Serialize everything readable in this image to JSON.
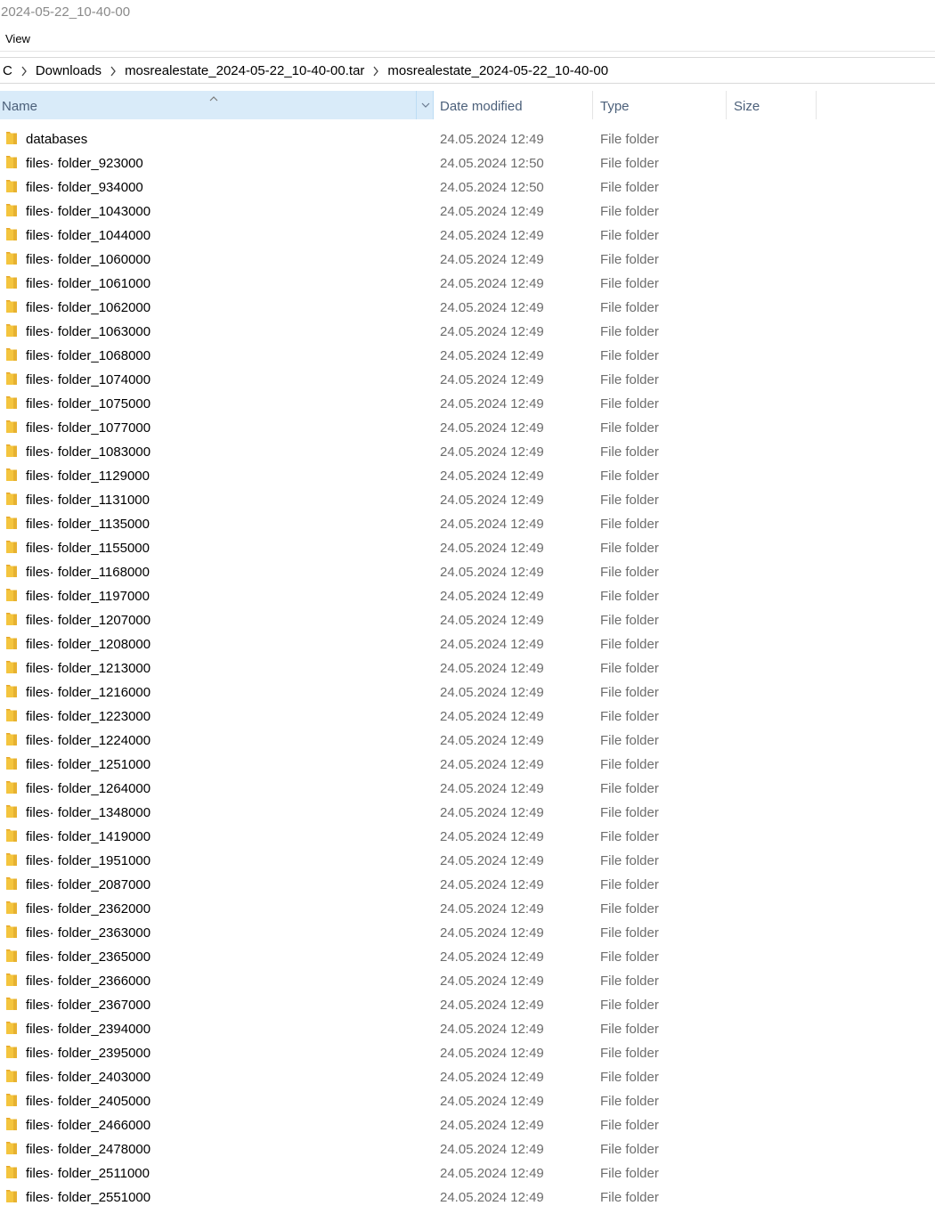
{
  "window": {
    "title": "2024-05-22_10-40-00"
  },
  "menu": {
    "view_label": "View"
  },
  "breadcrumb": [
    "C",
    "Downloads",
    "mosrealestate_2024-05-22_10-40-00.tar",
    "mosrealestate_2024-05-22_10-40-00"
  ],
  "columns": {
    "name": "Name",
    "date": "Date modified",
    "type": "Type",
    "size": "Size"
  },
  "colors": {
    "header_selected_bg": "#d9ebf9",
    "header_text": "#4c607a",
    "folder_icon": "#f4c53e",
    "secondary_text": "#6d6d6d"
  },
  "files": [
    {
      "name": "databases",
      "date": "24.05.2024 12:49",
      "type": "File folder",
      "size": ""
    },
    {
      "name": "files· folder_923000",
      "date": "24.05.2024 12:50",
      "type": "File folder",
      "size": ""
    },
    {
      "name": "files· folder_934000",
      "date": "24.05.2024 12:50",
      "type": "File folder",
      "size": ""
    },
    {
      "name": "files· folder_1043000",
      "date": "24.05.2024 12:49",
      "type": "File folder",
      "size": ""
    },
    {
      "name": "files· folder_1044000",
      "date": "24.05.2024 12:49",
      "type": "File folder",
      "size": ""
    },
    {
      "name": "files· folder_1060000",
      "date": "24.05.2024 12:49",
      "type": "File folder",
      "size": ""
    },
    {
      "name": "files· folder_1061000",
      "date": "24.05.2024 12:49",
      "type": "File folder",
      "size": ""
    },
    {
      "name": "files· folder_1062000",
      "date": "24.05.2024 12:49",
      "type": "File folder",
      "size": ""
    },
    {
      "name": "files· folder_1063000",
      "date": "24.05.2024 12:49",
      "type": "File folder",
      "size": ""
    },
    {
      "name": "files· folder_1068000",
      "date": "24.05.2024 12:49",
      "type": "File folder",
      "size": ""
    },
    {
      "name": "files· folder_1074000",
      "date": "24.05.2024 12:49",
      "type": "File folder",
      "size": ""
    },
    {
      "name": "files· folder_1075000",
      "date": "24.05.2024 12:49",
      "type": "File folder",
      "size": ""
    },
    {
      "name": "files· folder_1077000",
      "date": "24.05.2024 12:49",
      "type": "File folder",
      "size": ""
    },
    {
      "name": "files· folder_1083000",
      "date": "24.05.2024 12:49",
      "type": "File folder",
      "size": ""
    },
    {
      "name": "files· folder_1129000",
      "date": "24.05.2024 12:49",
      "type": "File folder",
      "size": ""
    },
    {
      "name": "files· folder_1131000",
      "date": "24.05.2024 12:49",
      "type": "File folder",
      "size": ""
    },
    {
      "name": "files· folder_1135000",
      "date": "24.05.2024 12:49",
      "type": "File folder",
      "size": ""
    },
    {
      "name": "files· folder_1155000",
      "date": "24.05.2024 12:49",
      "type": "File folder",
      "size": ""
    },
    {
      "name": "files· folder_1168000",
      "date": "24.05.2024 12:49",
      "type": "File folder",
      "size": ""
    },
    {
      "name": "files· folder_1197000",
      "date": "24.05.2024 12:49",
      "type": "File folder",
      "size": ""
    },
    {
      "name": "files· folder_1207000",
      "date": "24.05.2024 12:49",
      "type": "File folder",
      "size": ""
    },
    {
      "name": "files· folder_1208000",
      "date": "24.05.2024 12:49",
      "type": "File folder",
      "size": ""
    },
    {
      "name": "files· folder_1213000",
      "date": "24.05.2024 12:49",
      "type": "File folder",
      "size": ""
    },
    {
      "name": "files· folder_1216000",
      "date": "24.05.2024 12:49",
      "type": "File folder",
      "size": ""
    },
    {
      "name": "files· folder_1223000",
      "date": "24.05.2024 12:49",
      "type": "File folder",
      "size": ""
    },
    {
      "name": "files· folder_1224000",
      "date": "24.05.2024 12:49",
      "type": "File folder",
      "size": ""
    },
    {
      "name": "files· folder_1251000",
      "date": "24.05.2024 12:49",
      "type": "File folder",
      "size": ""
    },
    {
      "name": "files· folder_1264000",
      "date": "24.05.2024 12:49",
      "type": "File folder",
      "size": ""
    },
    {
      "name": "files· folder_1348000",
      "date": "24.05.2024 12:49",
      "type": "File folder",
      "size": ""
    },
    {
      "name": "files· folder_1419000",
      "date": "24.05.2024 12:49",
      "type": "File folder",
      "size": ""
    },
    {
      "name": "files· folder_1951000",
      "date": "24.05.2024 12:49",
      "type": "File folder",
      "size": ""
    },
    {
      "name": "files· folder_2087000",
      "date": "24.05.2024 12:49",
      "type": "File folder",
      "size": ""
    },
    {
      "name": "files· folder_2362000",
      "date": "24.05.2024 12:49",
      "type": "File folder",
      "size": ""
    },
    {
      "name": "files· folder_2363000",
      "date": "24.05.2024 12:49",
      "type": "File folder",
      "size": ""
    },
    {
      "name": "files· folder_2365000",
      "date": "24.05.2024 12:49",
      "type": "File folder",
      "size": ""
    },
    {
      "name": "files· folder_2366000",
      "date": "24.05.2024 12:49",
      "type": "File folder",
      "size": ""
    },
    {
      "name": "files· folder_2367000",
      "date": "24.05.2024 12:49",
      "type": "File folder",
      "size": ""
    },
    {
      "name": "files· folder_2394000",
      "date": "24.05.2024 12:49",
      "type": "File folder",
      "size": ""
    },
    {
      "name": "files· folder_2395000",
      "date": "24.05.2024 12:49",
      "type": "File folder",
      "size": ""
    },
    {
      "name": "files· folder_2403000",
      "date": "24.05.2024 12:49",
      "type": "File folder",
      "size": ""
    },
    {
      "name": "files· folder_2405000",
      "date": "24.05.2024 12:49",
      "type": "File folder",
      "size": ""
    },
    {
      "name": "files· folder_2466000",
      "date": "24.05.2024 12:49",
      "type": "File folder",
      "size": ""
    },
    {
      "name": "files· folder_2478000",
      "date": "24.05.2024 12:49",
      "type": "File folder",
      "size": ""
    },
    {
      "name": "files· folder_2511000",
      "date": "24.05.2024 12:49",
      "type": "File folder",
      "size": ""
    },
    {
      "name": "files· folder_2551000",
      "date": "24.05.2024 12:49",
      "type": "File folder",
      "size": ""
    }
  ]
}
